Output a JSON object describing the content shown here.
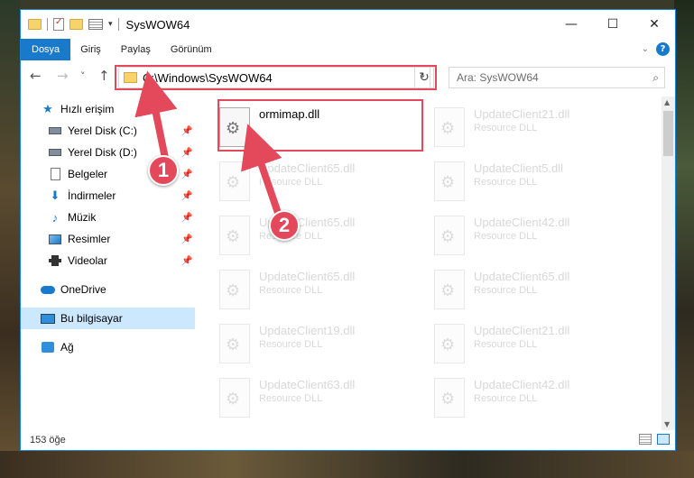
{
  "window": {
    "title": "SysWOW64",
    "controls": {
      "minimize": "—",
      "maximize": "☐",
      "close": "✕"
    }
  },
  "ribbon": {
    "tabs": [
      "Dosya",
      "Giriş",
      "Paylaş",
      "Görünüm"
    ],
    "expand_icon": "chevron-down-icon",
    "help_icon": "?"
  },
  "nav": {
    "back_icon": "←",
    "forward_icon": "→",
    "recent_icon": "˅",
    "up_icon": "↑",
    "address": "C:\\Windows\\SysWOW64",
    "search_placeholder": "Ara: SysWOW64",
    "search_icon": "⌕",
    "refresh_icon": "↻"
  },
  "sidebar": {
    "items": [
      {
        "label": "Hızlı erişim",
        "icon": "star-icon"
      },
      {
        "label": "Yerel Disk (C:)",
        "icon": "drive-icon",
        "pinned": true
      },
      {
        "label": "Yerel Disk (D:)",
        "icon": "drive-icon",
        "pinned": true
      },
      {
        "label": "Belgeler",
        "icon": "document-icon",
        "pinned": true
      },
      {
        "label": "İndirmeler",
        "icon": "download-icon",
        "pinned": true
      },
      {
        "label": "Müzik",
        "icon": "music-icon",
        "pinned": true
      },
      {
        "label": "Resimler",
        "icon": "pictures-icon",
        "pinned": true
      },
      {
        "label": "Videolar",
        "icon": "videos-icon",
        "pinned": true
      },
      {
        "label": "OneDrive",
        "icon": "cloud-icon"
      },
      {
        "label": "Bu bilgisayar",
        "icon": "computer-icon",
        "selected": true
      },
      {
        "label": "Ağ",
        "icon": "network-icon"
      }
    ]
  },
  "files": [
    {
      "name": "ormimap.dll",
      "type": ""
    },
    {
      "name": "UpdateClient21.dll",
      "type": "Resource DLL"
    },
    {
      "name": "UpdateClient65.dll",
      "type": "Resource DLL"
    },
    {
      "name": "UpdateClient5.dll",
      "type": "Resource DLL"
    },
    {
      "name": "UpdateClient65.dll",
      "type": "Resource DLL"
    },
    {
      "name": "UpdateClient42.dll",
      "type": "Resource DLL"
    },
    {
      "name": "UpdateClient65.dll",
      "type": "Resource DLL"
    },
    {
      "name": "UpdateClient65.dll",
      "type": "Resource DLL"
    },
    {
      "name": "UpdateClient19.dll",
      "type": "Resource DLL"
    },
    {
      "name": "UpdateClient21.dll",
      "type": "Resource DLL"
    },
    {
      "name": "UpdateClient63.dll",
      "type": "Resource DLL"
    },
    {
      "name": "UpdateClient42.dll",
      "type": "Resource DLL"
    }
  ],
  "status": {
    "count": "153 öğe"
  },
  "annotations": {
    "step1": "1",
    "step2": "2"
  },
  "colors": {
    "accent": "#1979ca",
    "highlight": "#e3485b",
    "selection": "#cce8ff"
  }
}
